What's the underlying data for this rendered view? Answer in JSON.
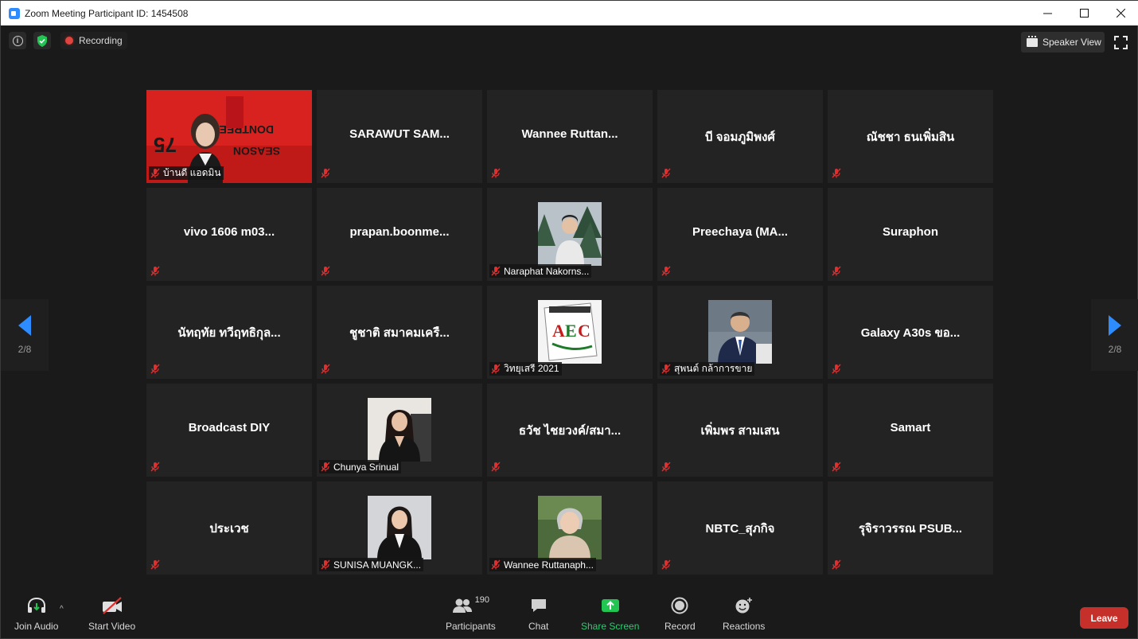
{
  "window": {
    "title": "Zoom Meeting Participant ID: 1454508",
    "minimize": "—",
    "maximize": "☐",
    "close": "✕"
  },
  "topbar": {
    "recording_label": "Recording",
    "speaker_view_label": "Speaker View"
  },
  "pagination": {
    "left_label": "2/8",
    "right_label": "2/8"
  },
  "participants": [
    {
      "name": "บ้านดี แอดมิน",
      "video": true,
      "kind": "video"
    },
    {
      "name": "SARAWUT  SAM...",
      "video": false
    },
    {
      "name": "Wannee  Ruttan...",
      "video": false
    },
    {
      "name": "บี จอมภูมิพงศ์",
      "video": false
    },
    {
      "name": "ณัชชา ธนเพิ่มสิน",
      "video": false
    },
    {
      "name": "vivo 1606  m03...",
      "video": false
    },
    {
      "name": "prapan.boonme...",
      "video": false
    },
    {
      "name": "Naraphat Nakorns...",
      "video": true,
      "kind": "photo-tree"
    },
    {
      "name": "Preechaya  (MA...",
      "video": false
    },
    {
      "name": "Suraphon",
      "video": false
    },
    {
      "name": "นัทฤทัย ทวีฤทธิกุล...",
      "video": false
    },
    {
      "name": "ชูชาติ สมาคมเครื...",
      "video": false
    },
    {
      "name": "วิทยุเสรี 2021",
      "video": true,
      "kind": "photo-aec"
    },
    {
      "name": "สุพนต์ กล้าการขาย",
      "video": true,
      "kind": "photo-suit"
    },
    {
      "name": "Galaxy A30s ขอ...",
      "video": false
    },
    {
      "name": "Broadcast DIY",
      "video": false
    },
    {
      "name": "Chunya Srinual",
      "video": true,
      "kind": "photo-woman1"
    },
    {
      "name": "ธวัช ไชยวงค์/สมา...",
      "video": false
    },
    {
      "name": "เพิ่มพร สามเสน",
      "video": false
    },
    {
      "name": "Samart",
      "video": false
    },
    {
      "name": "ประเวช",
      "video": false
    },
    {
      "name": "SUNISA MUANGK...",
      "video": true,
      "kind": "photo-woman2"
    },
    {
      "name": "Wannee Ruttanaph...",
      "video": true,
      "kind": "photo-woman3"
    },
    {
      "name": "NBTC_สุภกิจ",
      "video": false
    },
    {
      "name": "รุจิราวรรณ PSUB...",
      "video": false
    }
  ],
  "toolbar": {
    "join_audio": "Join Audio",
    "start_video": "Start Video",
    "participants": "Participants",
    "participants_count": "190",
    "chat": "Chat",
    "share_screen": "Share Screen",
    "record": "Record",
    "reactions": "Reactions",
    "leave": "Leave"
  },
  "colors": {
    "accent": "#2d8cff",
    "share_green": "#23c552",
    "leave_red": "#c5312a",
    "mute_red": "#e02f2f",
    "tile_bg": "#232323"
  }
}
